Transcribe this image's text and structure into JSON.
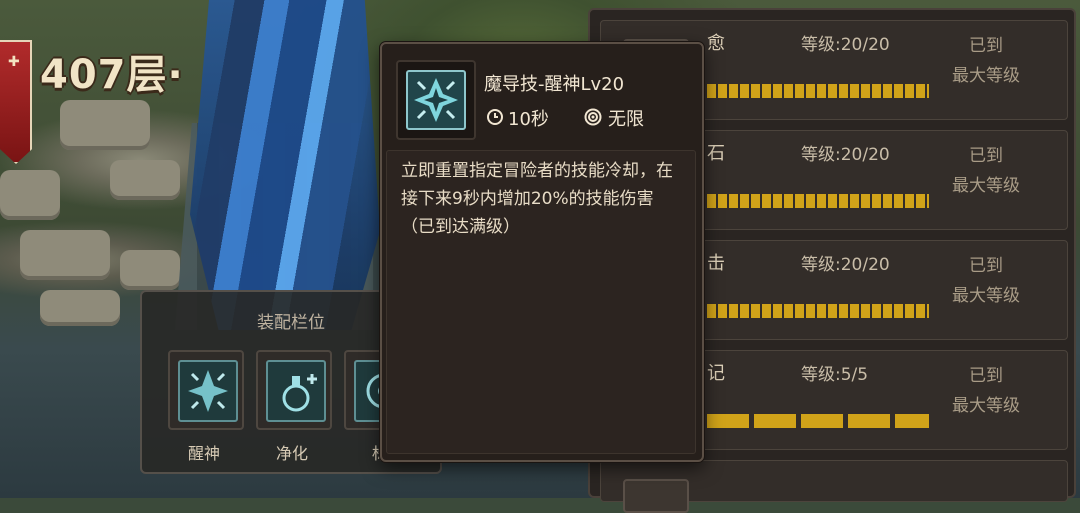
{
  "floor": {
    "label": "407层·"
  },
  "tooltip": {
    "title": "魔导技-醒神Lv20",
    "cooldown": "10秒",
    "range": "无限",
    "description": "立即重置指定冒险者的技能冷却，在接下来9秒内增加20%的技能伤害（已到达满级）"
  },
  "equip_panel": {
    "title": "装配栏位",
    "slots": [
      {
        "label": "醒神",
        "icon": "awaken-icon"
      },
      {
        "label": "净化",
        "icon": "purify-potion-icon"
      },
      {
        "label": "标",
        "icon": "mark-target-icon"
      }
    ]
  },
  "skill_list": [
    {
      "name": "愈",
      "level": "等级:20/20",
      "status": "已到\n最大等级",
      "progress": 1.0,
      "segments": 20
    },
    {
      "name": "石",
      "level": "等级:20/20",
      "status": "已到\n最大等级",
      "progress": 1.0,
      "segments": 20
    },
    {
      "name": "击",
      "level": "等级:20/20",
      "status": "已到\n最大等级",
      "progress": 1.0,
      "segments": 20
    },
    {
      "name": "记",
      "level": "等级:5/5",
      "status": "已到\n最大等级",
      "progress": 1.0,
      "segments": 5
    }
  ],
  "colors": {
    "accent_gold": "#d1a319",
    "tooltip_bg": "#261f1b",
    "icon_teal": "#8ec7cc"
  }
}
